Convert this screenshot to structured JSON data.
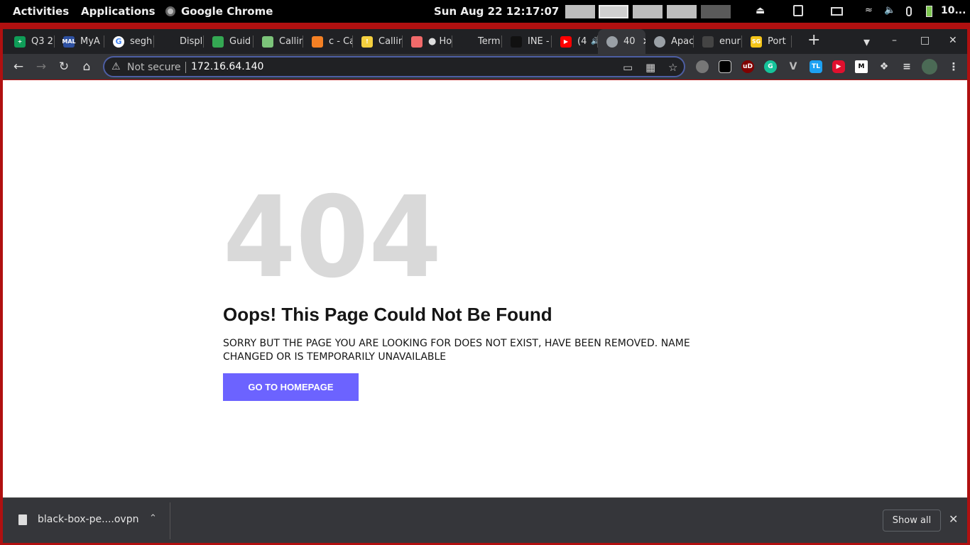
{
  "topbar": {
    "activities": "Activities",
    "applications": "Applications",
    "app_name": "Google Chrome",
    "clock": "Sun Aug 22  12:17:07",
    "battery": "10..."
  },
  "tabs": [
    {
      "label": "Q3 2",
      "color": "#0f9d58",
      "glyph": "+"
    },
    {
      "label": "MyA",
      "color": "#2e51a2",
      "glyph": "MAL"
    },
    {
      "label": "segh",
      "color": "#ffffff",
      "glyph": "G"
    },
    {
      "label": "Displ",
      "color": "#202124",
      "glyph": ""
    },
    {
      "label": "Guid",
      "color": "#34a853",
      "glyph": ""
    },
    {
      "label": "Callin",
      "color": "#7cc47a",
      "glyph": ""
    },
    {
      "label": "c - Ca",
      "color": "#f48024",
      "glyph": ""
    },
    {
      "label": "Callin",
      "color": "#f4d03f",
      "glyph": "!"
    },
    {
      "label": "● Ho",
      "color": "#f06a6a",
      "glyph": ""
    },
    {
      "label": "Term",
      "color": "#202124",
      "glyph": ""
    },
    {
      "label": "INE -",
      "color": "#111111",
      "glyph": ""
    },
    {
      "label": "(4",
      "color": "#ff0000",
      "glyph": "▶"
    },
    {
      "label": "40",
      "color": "#9aa0a6",
      "glyph": ""
    },
    {
      "label": "Apac",
      "color": "#9aa0a6",
      "glyph": ""
    },
    {
      "label": "enur",
      "color": "#444444",
      "glyph": ""
    },
    {
      "label": "Port",
      "color": "#f5c518",
      "glyph": "SG"
    }
  ],
  "toolbar": {
    "not_secure": "Not secure",
    "url": "172.16.64.140"
  },
  "page": {
    "big_number": "404",
    "heading": "Oops! This Page Could Not Be Found",
    "message": "SORRY BUT THE PAGE YOU ARE LOOKING FOR DOES NOT EXIST, HAVE BEEN REMOVED. NAME CHANGED OR IS TEMPORARILY UNAVAILABLE",
    "button": "GO TO HOMEPAGE",
    "button_color": "#6c63ff"
  },
  "downloads": {
    "file_name": "black-box-pe....ovpn",
    "show_all": "Show all"
  }
}
